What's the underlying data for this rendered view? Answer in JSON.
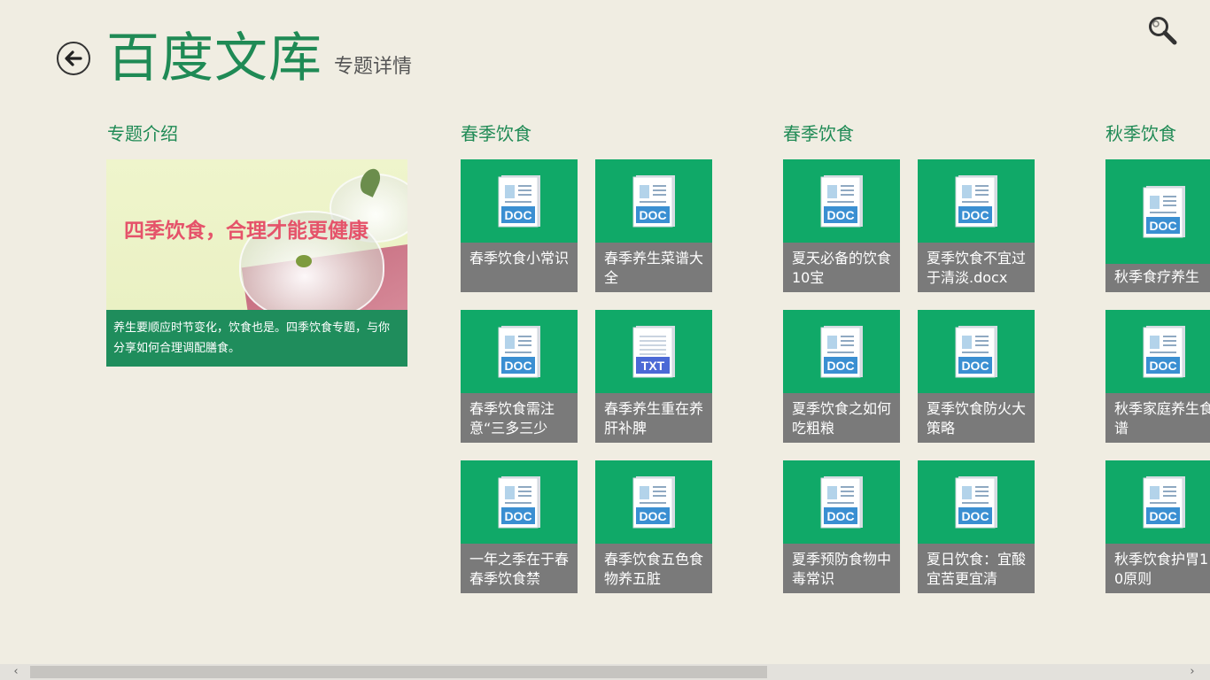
{
  "header": {
    "app_title": "百度文库",
    "page_subtitle": "专题详情"
  },
  "intro": {
    "section_title": "专题介绍",
    "slogan": "四季饮食，合理才能更健康",
    "description": "养生要顺应时节变化，饮食也是。四季饮食专题，与你分享如何合理调配膳食。"
  },
  "groups": [
    {
      "title": "春季饮食",
      "items": [
        {
          "title": "春季饮食小常识",
          "type": "DOC"
        },
        {
          "title": "春季养生菜谱大全",
          "type": "DOC"
        },
        {
          "title": "春季饮食需注意“三多三少",
          "type": "DOC"
        },
        {
          "title": "春季养生重在养肝补脾",
          "type": "TXT"
        },
        {
          "title": "一年之季在于春 春季饮食禁",
          "type": "DOC"
        },
        {
          "title": "春季饮食五色食物养五脏",
          "type": "DOC"
        }
      ]
    },
    {
      "title": "春季饮食",
      "items": [
        {
          "title": "夏天必备的饮食10宝",
          "type": "DOC"
        },
        {
          "title": "夏季饮食不宜过于清淡.docx",
          "type": "DOC"
        },
        {
          "title": "夏季饮食之如何吃粗粮",
          "type": "DOC"
        },
        {
          "title": "夏季饮食防火大策略",
          "type": "DOC"
        },
        {
          "title": "夏季预防食物中毒常识",
          "type": "DOC"
        },
        {
          "title": "夏日饮食：宜酸宜苦更宜清",
          "type": "DOC"
        }
      ]
    },
    {
      "title": "秋季饮食",
      "items": [
        {
          "title": "秋季食疗养生",
          "type": "DOC"
        },
        {
          "title": "秋季家庭养生食谱",
          "type": "DOC"
        },
        {
          "title": "秋季饮食护胃10原则",
          "type": "DOC"
        }
      ]
    }
  ],
  "scrollbar": {
    "left_arrow": "‹",
    "right_arrow": "›"
  },
  "colors": {
    "accent": "#1f8a55",
    "tile_green": "#10a968",
    "tile_label_gray": "#7a7a7a",
    "doc_blue": "#3a8fd2",
    "txt_blue": "#4b69d6",
    "background": "#f0ede2"
  }
}
